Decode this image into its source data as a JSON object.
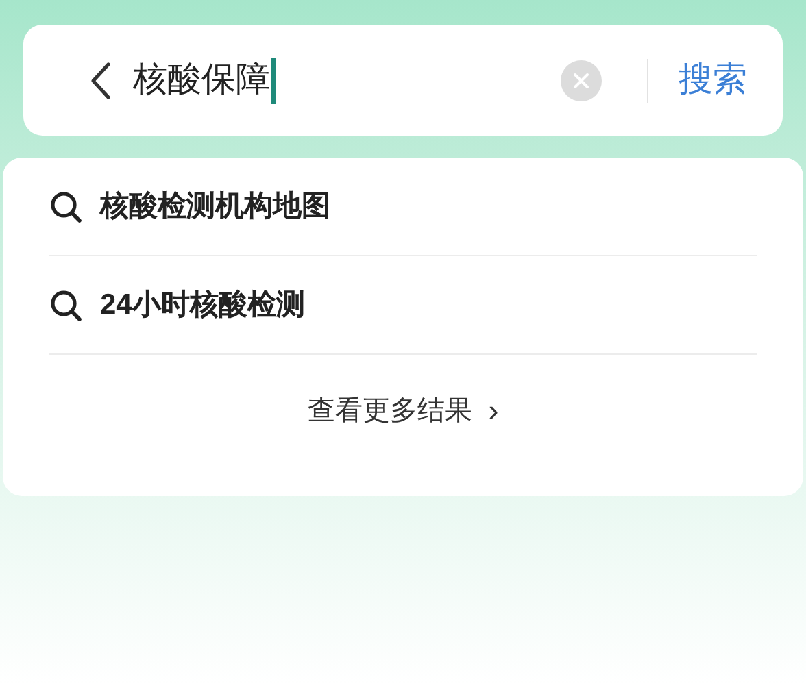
{
  "search_bar": {
    "value": "核酸保障",
    "button": "搜索"
  },
  "suggestions": [
    {
      "text": "核酸检测机构地图"
    },
    {
      "text": "24小时核酸检测"
    }
  ],
  "more_link": {
    "text": "查看更多结果",
    "arrow": "›"
  }
}
